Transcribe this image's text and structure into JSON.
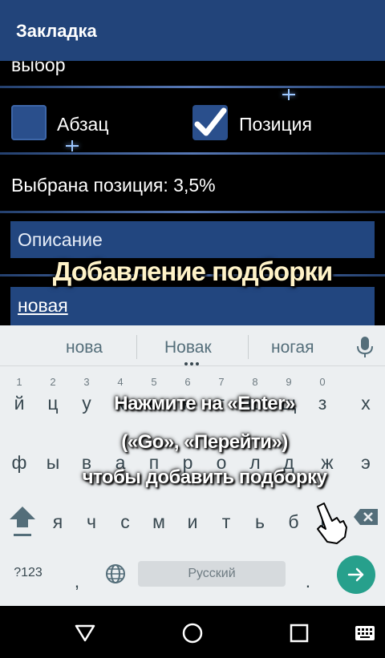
{
  "appbar": {
    "title": "Закладка"
  },
  "content": {
    "section_label": "выбор",
    "checkbox_paragraph": {
      "label": "Абзац",
      "checked": false
    },
    "checkbox_position": {
      "label": "Позиция",
      "checked": true
    },
    "selected_position": "Выбрана позиция: 3,5%",
    "description_placeholder": "Описание",
    "name_value": "новая"
  },
  "overlay": {
    "title": "Добавление подборки",
    "hint_line1": "Нажмите на «Enter»",
    "hint_line2": "(«Go», «Перейти»)",
    "hint_line3": "чтобы добавить подборку"
  },
  "keyboard": {
    "suggestions": [
      "нова",
      "Новак",
      "ногая"
    ],
    "row1": [
      {
        "n": "1",
        "l": "й"
      },
      {
        "n": "2",
        "l": "ц"
      },
      {
        "n": "3",
        "l": "у"
      },
      {
        "n": "4",
        "l": "к"
      },
      {
        "n": "5",
        "l": "е"
      },
      {
        "n": "6",
        "l": "н"
      },
      {
        "n": "7",
        "l": "г"
      },
      {
        "n": "8",
        "l": "ш"
      },
      {
        "n": "9",
        "l": "щ"
      },
      {
        "n": "0",
        "l": "з"
      },
      {
        "n": "",
        "l": "х"
      }
    ],
    "row2": [
      "ф",
      "ы",
      "в",
      "а",
      "п",
      "р",
      "о",
      "л",
      "д",
      "ж",
      "э"
    ],
    "row3": [
      "я",
      "ч",
      "с",
      "м",
      "и",
      "т",
      "ь",
      "б",
      "ю"
    ],
    "sym_key": "?123",
    "comma": ",",
    "space_label": "Русский",
    "period": "."
  },
  "colors": {
    "appbar": "#22447a",
    "field": "#22467f",
    "accent_enter": "#27a08c"
  }
}
